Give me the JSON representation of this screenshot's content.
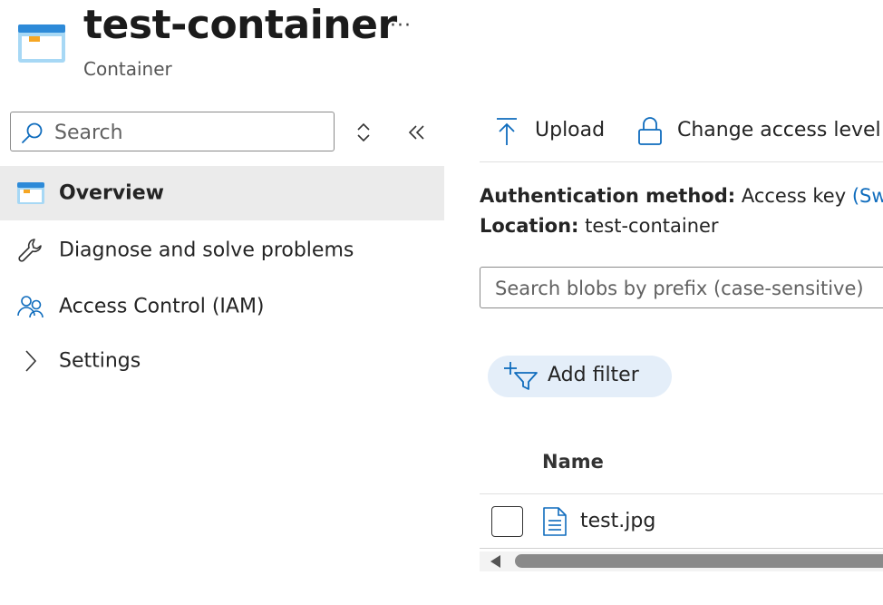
{
  "header": {
    "title": "test-container",
    "subtitle": "Container",
    "more_label": "···",
    "icon": "container-icon"
  },
  "sidebar": {
    "search_placeholder": "Search",
    "sort_icon": "sort-icon",
    "collapse_icon": "double-chevron-left-icon",
    "items": [
      {
        "label": "Overview",
        "icon": "container-icon",
        "active": true
      },
      {
        "label": "Diagnose and solve problems",
        "icon": "wrench-icon",
        "active": false
      },
      {
        "label": "Access Control (IAM)",
        "icon": "people-icon",
        "active": false
      },
      {
        "label": "Settings",
        "icon": "chevron-right-icon",
        "active": false
      }
    ]
  },
  "toolbar": {
    "upload_label": "Upload",
    "change_access_label": "Change access level"
  },
  "info": {
    "auth_key": "Authentication method:",
    "auth_value": "Access key",
    "auth_link": "(Sw",
    "location_key": "Location:",
    "location_value": "test-container"
  },
  "blobs": {
    "search_placeholder": "Search blobs by prefix (case-sensitive)",
    "add_filter_label": "Add filter",
    "column_name": "Name",
    "rows": [
      {
        "name": "test.jpg",
        "icon": "file-icon"
      }
    ]
  },
  "colors": {
    "accent": "#0f6cbd",
    "nav_active_bg": "#ebebeb",
    "filter_pill_bg": "#e4eef9",
    "container_icon_blue": "#2d8ad8",
    "container_icon_light": "#a7d8f5"
  }
}
